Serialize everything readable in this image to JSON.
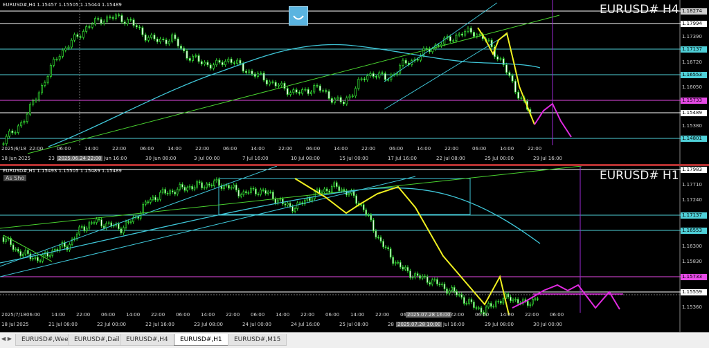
{
  "pane_top": {
    "header_text": "EURUSD#,H4  1.15457 1.15505 1.15444 1.15489",
    "big_label": "EURUSD# H4",
    "price_tags": [
      {
        "text": "1.18274",
        "color": "#ffffff",
        "bg": "#cfcfcf",
        "fg": "#000"
      },
      {
        "text": "1.17994",
        "color": "#ffffff",
        "bg": "#ffffff",
        "fg": "#000"
      },
      {
        "text": "1.17390",
        "color": "none",
        "bg": "",
        "fg": "#ccc"
      },
      {
        "text": "1.17137",
        "color": "#4fd0d8",
        "bg": "#4fd0d8",
        "fg": "#000"
      },
      {
        "text": "1.16720",
        "color": "none",
        "bg": "",
        "fg": "#ccc"
      },
      {
        "text": "1.16553",
        "color": "#4fd0d8",
        "bg": "#4fd0d8",
        "fg": "#000"
      },
      {
        "text": "1.16050",
        "color": "none",
        "bg": "",
        "fg": "#ccc"
      },
      {
        "text": "1.15733",
        "color": "#e64ae6",
        "bg": "#e64ae6",
        "fg": "#000"
      },
      {
        "text": "1.15489",
        "color": "#ffffff",
        "bg": "#ffffff",
        "fg": "#000"
      },
      {
        "text": "1.15380",
        "color": "none",
        "bg": "",
        "fg": "#ccc"
      },
      {
        "text": "1.14801",
        "color": "#4fd0d8",
        "bg": "#4fd0d8",
        "fg": "#000"
      }
    ],
    "time_ticks": [
      "18 Jun 2025",
      "23",
      "2025.06.24 22:00",
      "Jun 16:00",
      "30 Jun 08:00",
      "3 Jul 00:00",
      "7 Jul 16:00",
      "10 Jul 08:00",
      "15 Jul 00:00",
      "17 Jul 16:00",
      "22 Jul 08:00",
      "25 Jul 00:00",
      "29 Jul 16:00"
    ],
    "hour_ticks": [
      "2025/6/18",
      "22:00",
      "06:00",
      "14:00",
      "22:00",
      "06:00",
      "14:00",
      "22:00",
      "06:00",
      "14:00",
      "22:00",
      "06:00",
      "14:00",
      "22:00",
      "06:00",
      "14:00",
      "22:00",
      "06:00",
      "14:00",
      "22:00"
    ]
  },
  "pane_bottom": {
    "header_text": "EURUSD#,H1  1.15493 1.15505 1.15489 1.15489",
    "big_label": "EURUSD# H1",
    "as_shown": "As Sho",
    "price_tags": [
      {
        "text": "1.17983",
        "color": "#ffffff",
        "bg": "#ffffff",
        "fg": "#000"
      },
      {
        "text": "1.17710",
        "color": "none",
        "bg": "",
        "fg": "#ccc"
      },
      {
        "text": "1.17240",
        "color": "none",
        "bg": "",
        "fg": "#ccc"
      },
      {
        "text": "1.17137",
        "color": "#4fd0d8",
        "bg": "#4fd0d8",
        "fg": "#000"
      },
      {
        "text": "1.16553",
        "color": "#4fd0d8",
        "bg": "#4fd0d8",
        "fg": "#000"
      },
      {
        "text": "1.16300",
        "color": "none",
        "bg": "",
        "fg": "#ccc"
      },
      {
        "text": "1.15830",
        "color": "none",
        "bg": "",
        "fg": "#ccc"
      },
      {
        "text": "1.15733",
        "color": "#e64ae6",
        "bg": "#e64ae6",
        "fg": "#000"
      },
      {
        "text": "1.15559",
        "color": "#ffffff",
        "bg": "#ffffff",
        "fg": "#000"
      },
      {
        "text": "1.15360",
        "color": "none",
        "bg": "",
        "fg": "#ccc"
      }
    ],
    "time_ticks": [
      "18 Jul 2025",
      "21 Jul 08:00",
      "22 Jul 00:00",
      "22 Jul 16:00",
      "23 Jul 08:00",
      "24 Jul 00:00",
      "24 Jul 16:00",
      "25 Jul 08:00",
      "28",
      "2025.07.28 10:00",
      "Jul 16:00",
      "29 Jul 08:00",
      "30 Jul 00:00"
    ],
    "hour_ticks": [
      "2025/7/18",
      "06:00",
      "14:00",
      "22:00",
      "06:00",
      "14:00",
      "22:00",
      "06:00",
      "14:00",
      "22:00",
      "06:00",
      "14:00",
      "22:00",
      "06:00",
      "14:00",
      "22:00",
      "06:00",
      "14:00",
      "22:00",
      "06:00",
      "14:00",
      "22:00",
      "06:00"
    ],
    "selected_time": "2025.07.28 16:00"
  },
  "tabs": [
    "EURUSD#,Weekly",
    "EURUSD#,Daily",
    "EURUSD#,H4",
    "EURUSD#,H1",
    "EURUSD#,M15"
  ],
  "active_tab": "EURUSD#,H1"
}
